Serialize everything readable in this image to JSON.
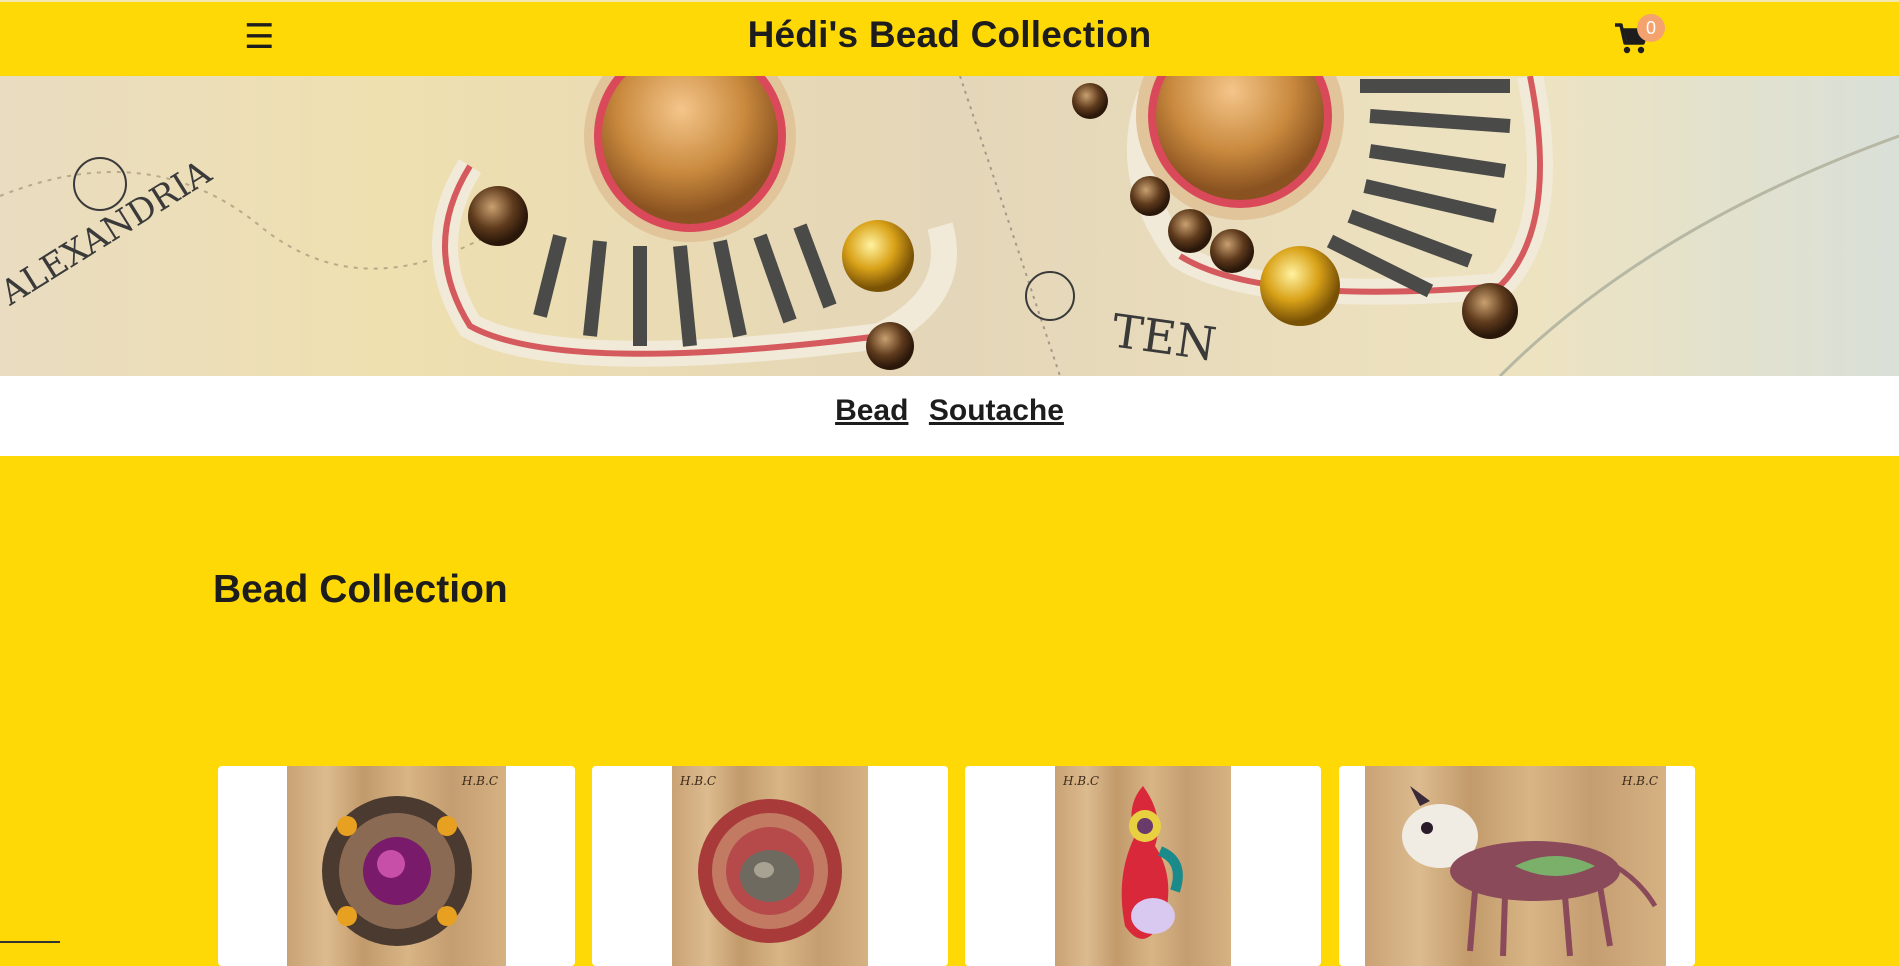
{
  "header": {
    "title": "Hédi's Bead Collection",
    "cart_count": "0",
    "menu_icon": "hamburger-icon",
    "cart_icon": "shopping-cart-icon"
  },
  "categories": {
    "items": [
      "Bead",
      "Soutache"
    ]
  },
  "section": {
    "title": "Bead Collection"
  },
  "products": [
    {
      "watermark": "H.B.C"
    },
    {
      "watermark": "H.B.C"
    },
    {
      "watermark": "H.B.C"
    },
    {
      "watermark": "H.B.C"
    }
  ],
  "colors": {
    "brand_yellow": "#FFD905",
    "cart_badge": "#f4a36f",
    "text_dark": "#1d1d1d"
  }
}
